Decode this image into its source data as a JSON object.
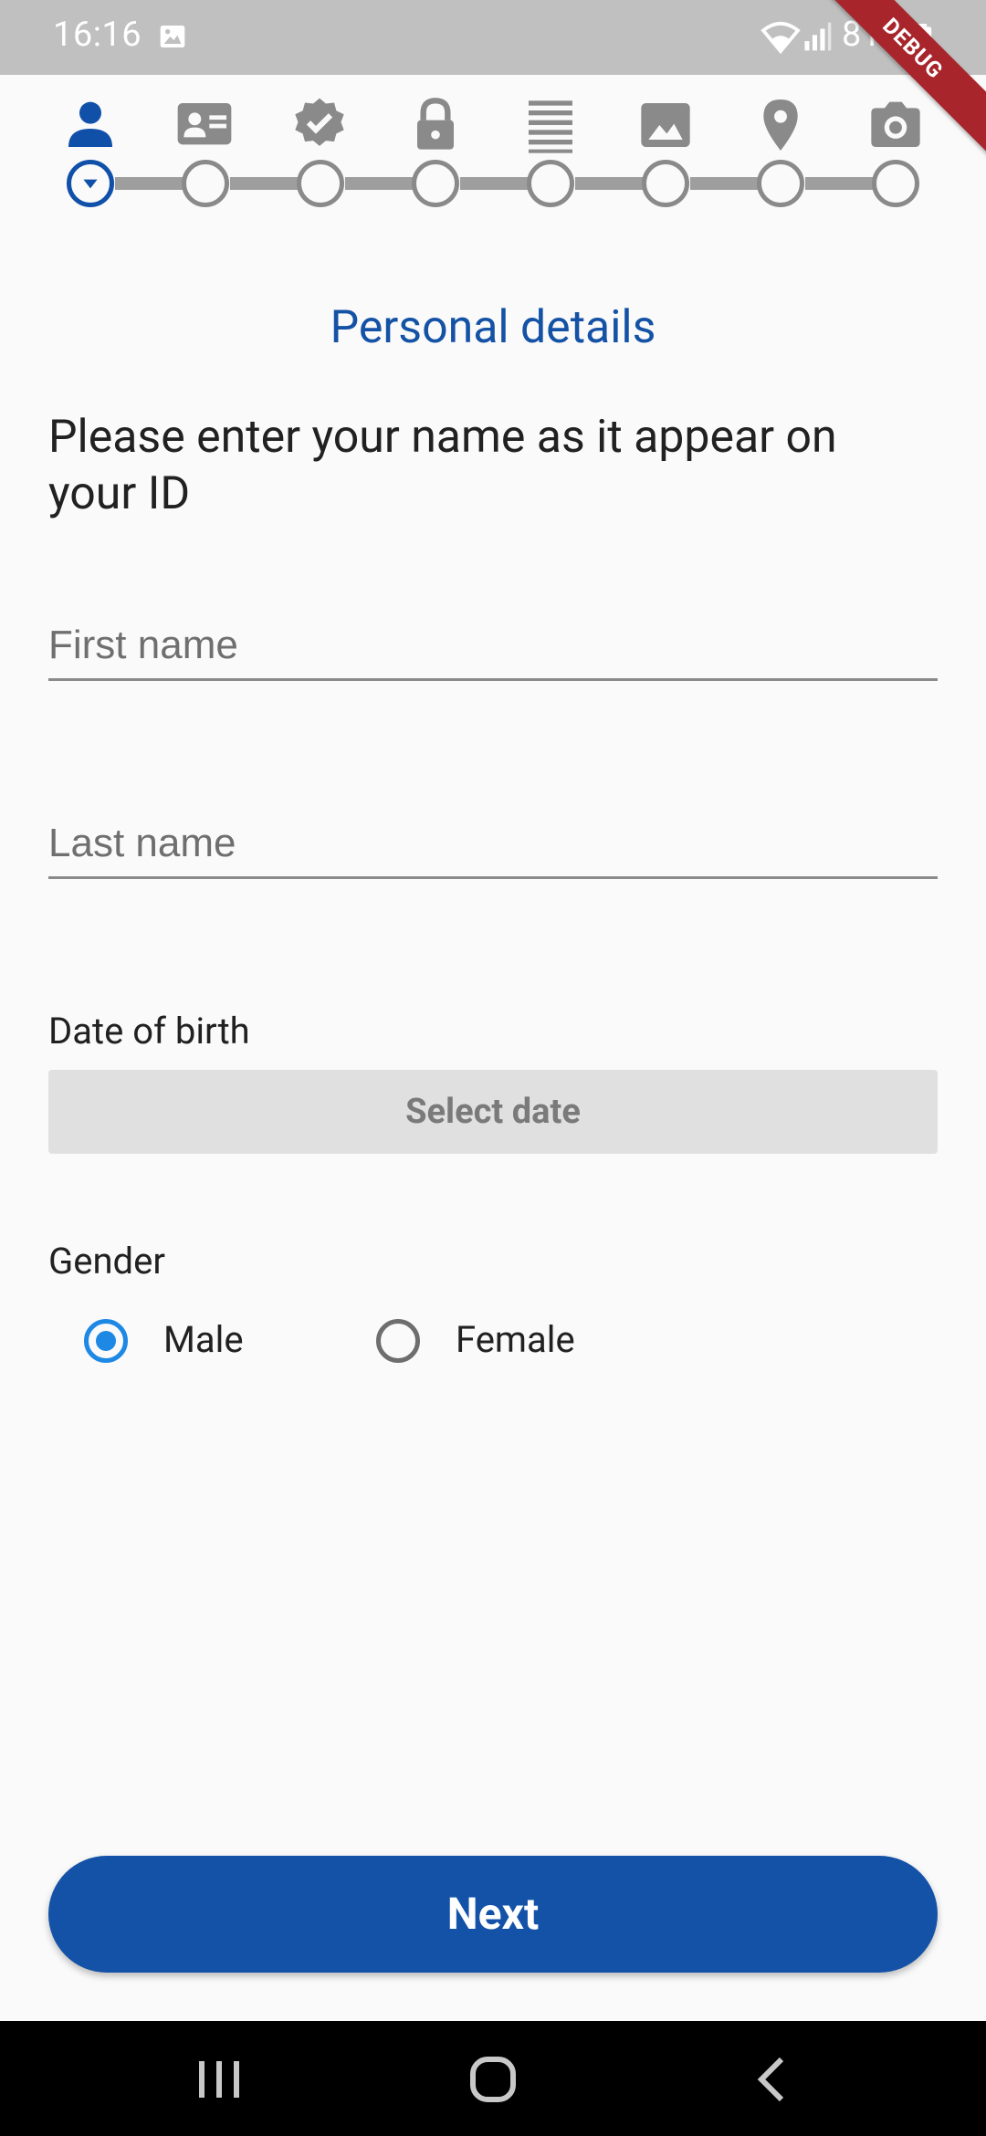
{
  "status_bar": {
    "time": "16:16",
    "battery": "81%",
    "debug_banner": "DEBUG",
    "gallery_icon": "image-icon",
    "wifi_icon": "wifi-icon",
    "signal_icon": "signal-icon",
    "battery_icon": "battery-icon"
  },
  "stepper": {
    "current_step": 1,
    "total_steps": 8,
    "active_color": "#1150a9",
    "inactive_color": "#8a8a8a",
    "steps": [
      {
        "icon": "person-icon"
      },
      {
        "icon": "id-card-icon"
      },
      {
        "icon": "verified-badge-icon"
      },
      {
        "icon": "lock-icon"
      },
      {
        "icon": "document-lines-icon"
      },
      {
        "icon": "image-icon"
      },
      {
        "icon": "location-pin-icon"
      },
      {
        "icon": "camera-icon"
      }
    ]
  },
  "page": {
    "title": "Personal details",
    "instruction": "Please enter your name as it appear on your ID"
  },
  "form": {
    "first_name": {
      "value": "",
      "placeholder": "First name"
    },
    "last_name": {
      "value": "",
      "placeholder": "Last name"
    },
    "dob_label": "Date of birth",
    "dob_button": "Select date",
    "gender_label": "Gender",
    "gender_options": [
      "Male",
      "Female"
    ],
    "gender_selected": "Male"
  },
  "actions": {
    "next_label": "Next"
  },
  "colors": {
    "primary": "#1452a8",
    "radio_selected": "#1e88e5",
    "background": "#fafafa"
  }
}
